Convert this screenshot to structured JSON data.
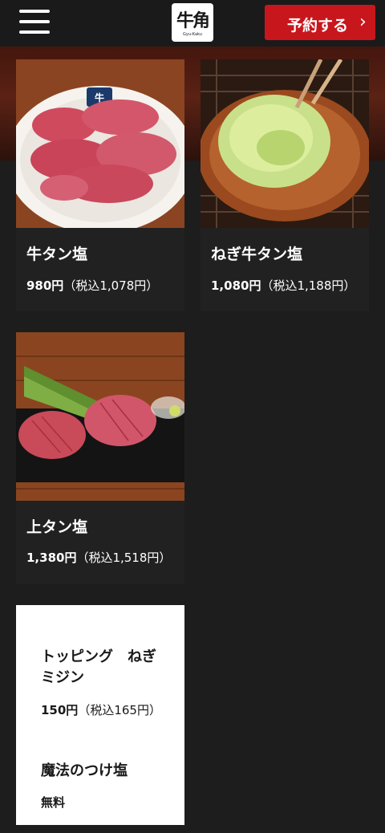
{
  "header": {
    "logo_text": "牛角",
    "logo_sub": "Gyu-Kaku",
    "reserve_label": "予約する",
    "reserve_chevron": "›"
  },
  "menu": {
    "items": [
      {
        "title": "牛タン塩",
        "price": "980円",
        "tax": "（税込1,078円）"
      },
      {
        "title": "ねぎ牛タン塩",
        "price": "1,080円",
        "tax": "（税込1,188円）"
      },
      {
        "title": "上タン塩",
        "price": "1,380円",
        "tax": "（税込1,518円）"
      }
    ],
    "extras": [
      {
        "title": "トッピング　ねぎミジン",
        "price": "150円",
        "tax": "（税込165円）"
      },
      {
        "title": "魔法のつけ塩",
        "price": "無料"
      }
    ]
  },
  "colors": {
    "accent": "#c8161d",
    "background": "#1d1d1d",
    "card": "#212121"
  }
}
